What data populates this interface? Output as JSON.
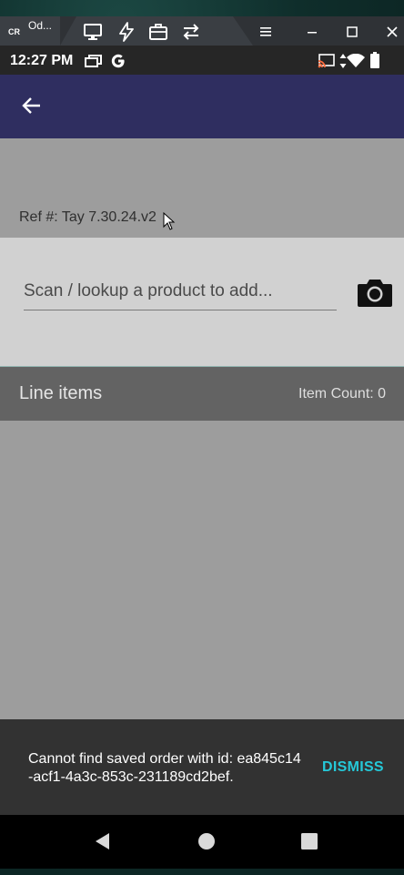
{
  "window": {
    "tab_logo": "CR",
    "tab_title": "Od...",
    "tools": [
      "monitor-icon",
      "lightning-icon",
      "briefcase-icon",
      "swap-arrows-icon"
    ],
    "controls": [
      "list-icon",
      "minimize-icon",
      "maximize-icon",
      "close-icon"
    ]
  },
  "status_bar": {
    "time": "12:27 PM",
    "left_icons": [
      "recent-apps-icon",
      "google-icon"
    ],
    "right_icons": [
      "cast-icon",
      "data-arrows-icon",
      "wifi-icon",
      "battery-icon"
    ]
  },
  "app_bar": {
    "back_icon": "arrow-left-icon",
    "color": "#2f2e60"
  },
  "order": {
    "ref_text": "Ref #: Tay 7.30.24.v2"
  },
  "scan": {
    "placeholder": "Scan / lookup a product to add...",
    "value": "",
    "camera_icon": "camera-icon"
  },
  "line_items": {
    "title": "Line items",
    "count_text": "Item Count: 0"
  },
  "snackbar": {
    "message": "Cannot find saved order with id: ea845c14-acf1-4a3c-853c-231189cd2bef.",
    "action": "DISMISS",
    "action_color": "#25c8d8"
  },
  "nav_bar": {
    "buttons": [
      "back-triangle-icon",
      "home-circle-icon",
      "recents-square-icon"
    ]
  }
}
